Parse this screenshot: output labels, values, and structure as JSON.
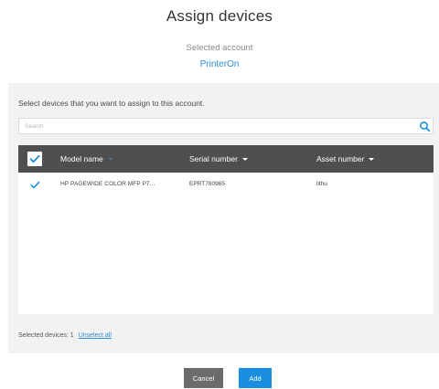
{
  "dialog": {
    "title": "Assign devices",
    "account_label": "Selected account",
    "account_name": "PrinterOn",
    "instruction": "Select devices that you want to assign to this account.",
    "search_placeholder": "Search"
  },
  "table": {
    "columns": [
      {
        "label": "Model name"
      },
      {
        "label": "Serial number"
      },
      {
        "label": "Asset number"
      }
    ],
    "rows": [
      {
        "selected": true,
        "model": "HP PAGEWIDE COLOR MFP P7...",
        "serial": "EPRT780965",
        "asset": "lithu"
      }
    ]
  },
  "footer": {
    "selected_label": "Selected devices: 1",
    "unselect_all": "Unselect all"
  },
  "buttons": {
    "cancel": "Cancel",
    "add": "Add"
  },
  "colors": {
    "accent": "#1a8fe0",
    "header_bg": "#4f4f4f",
    "cancel_bg": "#6b6b6b",
    "link": "#2b8fd6"
  }
}
